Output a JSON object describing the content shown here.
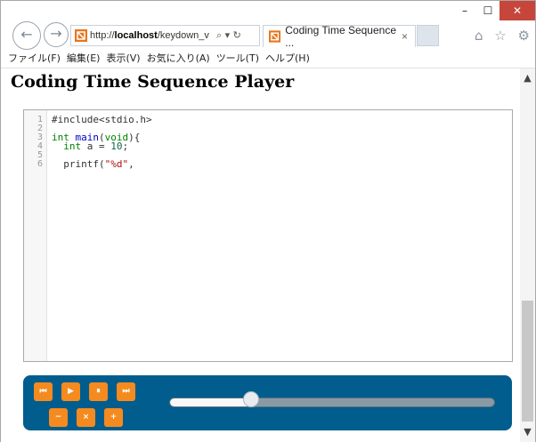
{
  "window": {
    "controls": {
      "minimize": "–",
      "maximize": "☐",
      "close": "✕"
    }
  },
  "toolbar": {
    "back": "←",
    "forward": "→",
    "address_host": "http://",
    "address_bold": "localhost",
    "address_rest": "/keydown_v",
    "address_tools": "⌕ ▾ ↻",
    "right_icons": "⌂ ☆ ⚙"
  },
  "tab": {
    "title": "Coding Time Sequence ...",
    "close": "×"
  },
  "menu": {
    "items": [
      "ファイル(F)",
      "編集(E)",
      "表示(V)",
      "お気に入り(A)",
      "ツール(T)",
      "ヘルプ(H)"
    ]
  },
  "page": {
    "title": "Coding Time Sequence Player"
  },
  "editor": {
    "lines": [
      {
        "n": "1",
        "segments": [
          {
            "t": "#include<stdio.h>",
            "c": "plain"
          }
        ]
      },
      {
        "n": "2",
        "segments": []
      },
      {
        "n": "3",
        "segments": [
          {
            "t": "int",
            "c": "kw"
          },
          {
            "t": " ",
            "c": "plain"
          },
          {
            "t": "main",
            "c": "fn"
          },
          {
            "t": "(",
            "c": "plain"
          },
          {
            "t": "void",
            "c": "kw"
          },
          {
            "t": "){",
            "c": "plain"
          }
        ]
      },
      {
        "n": "4",
        "segments": [
          {
            "t": "  ",
            "c": "plain"
          },
          {
            "t": "int",
            "c": "kw"
          },
          {
            "t": " a = ",
            "c": "plain"
          },
          {
            "t": "10",
            "c": "num-lit"
          },
          {
            "t": ";",
            "c": "plain"
          }
        ]
      },
      {
        "n": "5",
        "segments": []
      },
      {
        "n": "6",
        "segments": [
          {
            "t": "  printf(",
            "c": "plain"
          },
          {
            "t": "\"%d\"",
            "c": "str"
          },
          {
            "t": ",",
            "c": "plain"
          }
        ]
      }
    ]
  },
  "player": {
    "buttons_top": [
      {
        "name": "skip-start-button",
        "label": "⏮"
      },
      {
        "name": "play-button",
        "label": "▶"
      },
      {
        "name": "pause-button",
        "label": "⏸"
      },
      {
        "name": "skip-end-button",
        "label": "⏭"
      }
    ],
    "buttons_bottom": [
      {
        "name": "speed-down-button",
        "label": "−"
      },
      {
        "name": "speed-reset-button",
        "label": "×"
      },
      {
        "name": "speed-up-button",
        "label": "+"
      }
    ],
    "progress": 0.25
  },
  "colors": {
    "player_bg": "#005d8e",
    "button_orange": "#f58a1f",
    "close_red": "#c7463c"
  }
}
